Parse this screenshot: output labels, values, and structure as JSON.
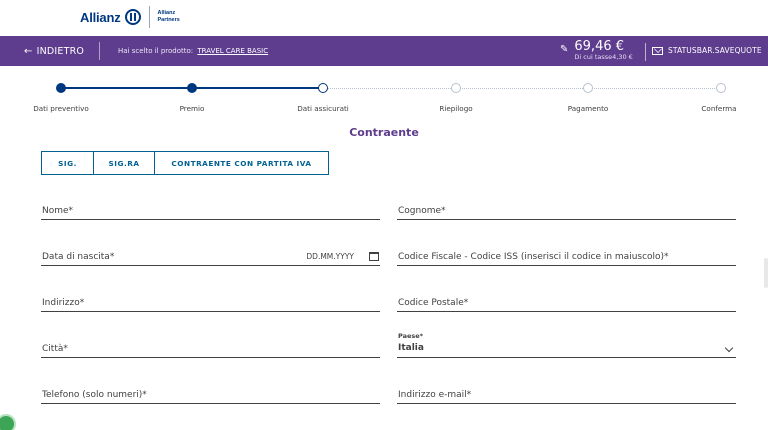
{
  "brand": {
    "name": "Allianz",
    "partners_line1": "Allianz",
    "partners_line2": "Partners"
  },
  "topbar": {
    "back_label": "INDIETRO",
    "chosen_prefix": "Hai scelto il prodotto:",
    "product": "TRAVEL CARE BASIC",
    "price": "69,46 €",
    "tax": "Di cui tasse4,30 €",
    "save_quote": "STATUSBAR.SAVEQUOTE"
  },
  "stepper": {
    "current_index": 2,
    "steps": [
      "Dati preventivo",
      "Premio",
      "Dati assicurati",
      "Riepilogo",
      "Pagamento",
      "Conferma"
    ]
  },
  "section_title": "Contraente",
  "toggle": {
    "options": [
      "SIG.",
      "SIG.RA",
      "CONTRAENTE CON PARTITA IVA"
    ]
  },
  "form": {
    "nome": "Nome*",
    "cognome": "Cognome*",
    "data_nascita": "Data di nascita*",
    "date_mask": "DD.MM.YYYY",
    "codice_fiscale": "Codice Fiscale - Codice ISS (inserisci il codice in maiuscolo)*",
    "indirizzo": "Indirizzo*",
    "codice_postale": "Codice Postale*",
    "citta": "Città*",
    "paese_label": "Paese*",
    "paese_value": "Italia",
    "telefono": "Telefono (solo numeri)*",
    "email": "Indirizzo e-mail*"
  },
  "colors": {
    "brand_blue": "#003781",
    "purple": "#5e3c8e",
    "toggle_blue": "#006192"
  }
}
